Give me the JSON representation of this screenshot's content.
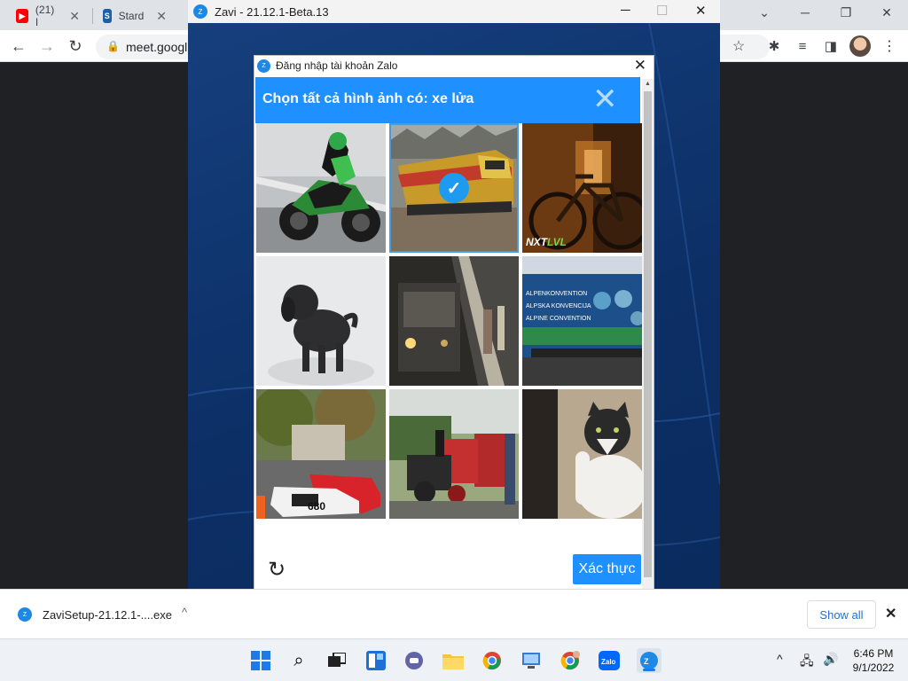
{
  "browser": {
    "tabs": [
      {
        "label": "(21) I",
        "icon": "youtube-icon",
        "color": "#ff0000"
      },
      {
        "label": "Stard",
        "icon": "stardock-icon",
        "color": "#1a5fa8"
      }
    ],
    "url": "meet.googl"
  },
  "zavi_window": {
    "title": "Zavi - 21.12.1-Beta.13"
  },
  "dialog": {
    "title": "Đăng nhập tài khoản Zalo",
    "prompt": "Chọn tất cả hình ảnh có: xe lửa",
    "verify_label": "Xác thực",
    "tiles": [
      {
        "subject": "motorcycle",
        "selected": false
      },
      {
        "subject": "train",
        "selected": true
      },
      {
        "subject": "bicycle",
        "selected": false,
        "overlay_text": "NXTLVL"
      },
      {
        "subject": "dog",
        "selected": false
      },
      {
        "subject": "subway-train",
        "selected": false
      },
      {
        "subject": "electric-locomotive",
        "selected": false,
        "overlay_text": "ALPENKONVENTION / ALPSKA KONVENCIJA / ALPINE CONVENTION"
      },
      {
        "subject": "race-cars",
        "selected": false,
        "overlay_text": "680"
      },
      {
        "subject": "steam-train",
        "selected": false
      },
      {
        "subject": "cat",
        "selected": false
      }
    ]
  },
  "download_bar": {
    "filename": "ZaviSetup-21.12.1-....exe",
    "show_all": "Show all"
  },
  "taskbar": {
    "time": "6:46 PM",
    "date": "9/1/2022",
    "accent": "#1e7ae8"
  },
  "colors": {
    "captcha_blue": "#1e90ff",
    "zavi_bg": "#0c2f66"
  }
}
